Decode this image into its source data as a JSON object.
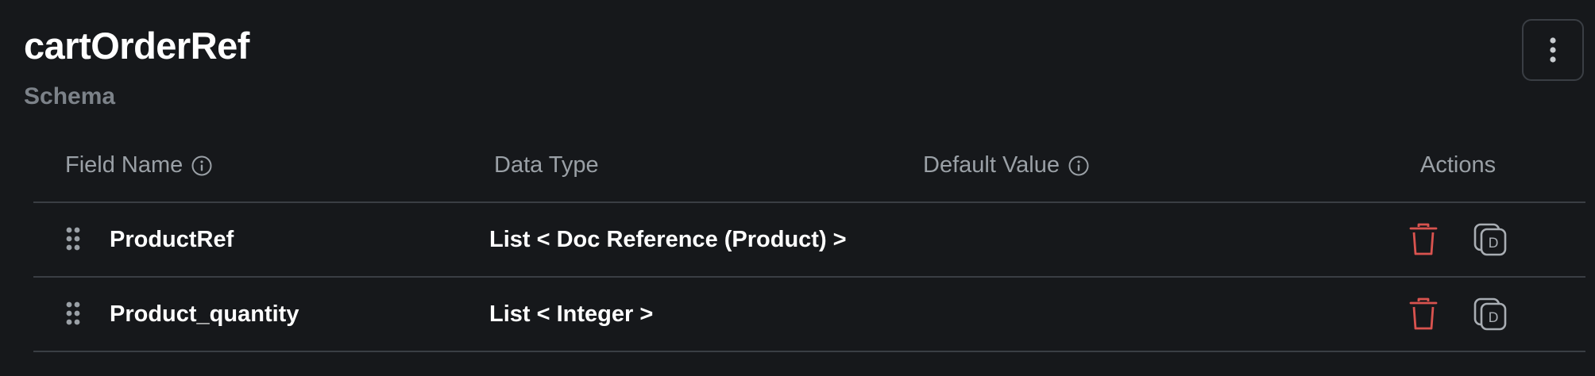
{
  "collection": {
    "name": "cartOrderRef",
    "section_label": "Schema"
  },
  "table": {
    "headers": {
      "field_name": "Field Name",
      "data_type": "Data Type",
      "default_value": "Default Value",
      "actions": "Actions"
    },
    "rows": [
      {
        "field_name": "ProductRef",
        "data_type": "List < Doc Reference (Product) >",
        "default_value": ""
      },
      {
        "field_name": "Product_quantity",
        "data_type": "List < Integer >",
        "default_value": ""
      }
    ]
  },
  "icons": {
    "menu": "more-vertical-icon",
    "info": "info-icon",
    "drag": "drag-handle-icon",
    "delete": "trash-icon",
    "duplicate": "duplicate-icon"
  },
  "colors": {
    "background": "#16181b",
    "divider": "#3a3e44",
    "muted_text": "#9aa0a6",
    "delete_red": "#d9534f"
  }
}
